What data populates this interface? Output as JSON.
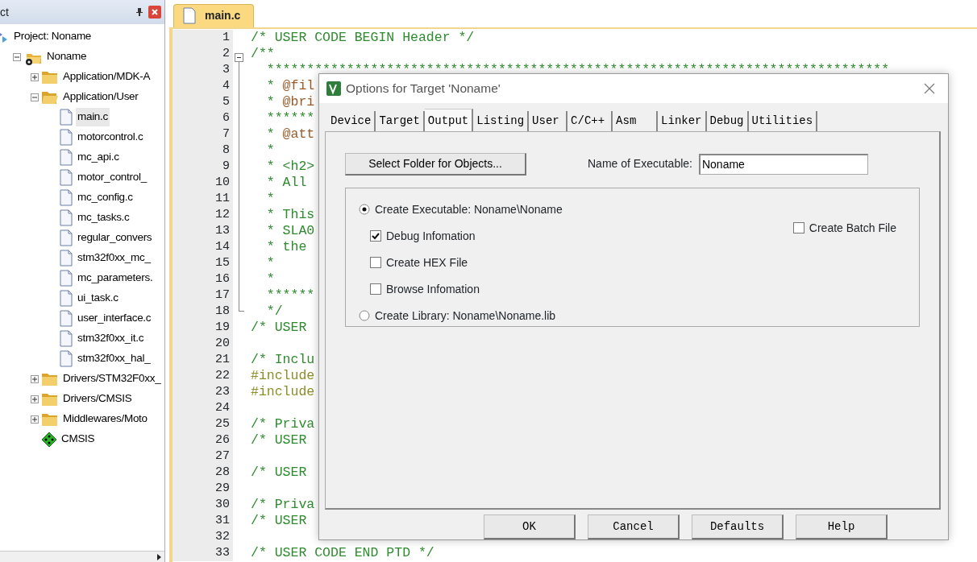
{
  "project_panel": {
    "title": "ct",
    "tree": [
      {
        "label": "Project: Noname",
        "kind": "project",
        "children": [
          {
            "label": "Noname",
            "kind": "target",
            "expanded": true,
            "children": [
              {
                "label": "Application/MDK-A",
                "kind": "folder",
                "expanded": false
              },
              {
                "label": "Application/User",
                "kind": "folder",
                "expanded": true,
                "children": [
                  {
                    "label": "main.c",
                    "kind": "file",
                    "selected": true
                  },
                  {
                    "label": "motorcontrol.c",
                    "kind": "file",
                    "selected": false
                  },
                  {
                    "label": "mc_api.c",
                    "kind": "file",
                    "selected": false
                  },
                  {
                    "label": "motor_control_",
                    "kind": "file",
                    "selected": false
                  },
                  {
                    "label": "mc_config.c",
                    "kind": "file",
                    "selected": false
                  },
                  {
                    "label": "mc_tasks.c",
                    "kind": "file",
                    "selected": false
                  },
                  {
                    "label": "regular_convers",
                    "kind": "file",
                    "selected": false
                  },
                  {
                    "label": "stm32f0xx_mc_",
                    "kind": "file",
                    "selected": false
                  },
                  {
                    "label": "mc_parameters.",
                    "kind": "file",
                    "selected": false
                  },
                  {
                    "label": "ui_task.c",
                    "kind": "file",
                    "selected": false
                  },
                  {
                    "label": "user_interface.c",
                    "kind": "file",
                    "selected": false
                  },
                  {
                    "label": "stm32f0xx_it.c",
                    "kind": "file",
                    "selected": false
                  },
                  {
                    "label": "stm32f0xx_hal_",
                    "kind": "file",
                    "selected": false
                  }
                ]
              },
              {
                "label": "Drivers/STM32F0xx_",
                "kind": "folder",
                "expanded": false
              },
              {
                "label": "Drivers/CMSIS",
                "kind": "folder",
                "expanded": false
              },
              {
                "label": "Middlewares/Moto",
                "kind": "folder",
                "expanded": false
              },
              {
                "label": "CMSIS",
                "kind": "component"
              }
            ]
          }
        ]
      }
    ]
  },
  "editor": {
    "tab": "main.c",
    "lines": [
      {
        "number": "1",
        "kind": "comment",
        "text": "/* USER CODE BEGIN Header */"
      },
      {
        "number": "2",
        "kind": "comment",
        "text": "/**",
        "expanded": true,
        "children": [
          {
            "number": "3",
            "kind": "comment",
            "text": "  ******************************************************************************"
          },
          {
            "number": "4",
            "kind": "comment",
            "text": "  * ",
            "tag": "@fil"
          },
          {
            "number": "5",
            "kind": "comment",
            "text": "  * ",
            "tag": "@bri"
          },
          {
            "number": "6",
            "kind": "comment",
            "text": "  ******"
          },
          {
            "number": "7",
            "kind": "comment",
            "text": "  * ",
            "tag": "@att"
          },
          {
            "number": "8",
            "kind": "comment",
            "text": "  *"
          },
          {
            "number": "9",
            "kind": "comment",
            "text": "  * <h2>"
          },
          {
            "number": "10",
            "kind": "comment",
            "text": "  * All"
          },
          {
            "number": "11",
            "kind": "comment",
            "text": "  *"
          },
          {
            "number": "12",
            "kind": "comment",
            "text": "  * This"
          },
          {
            "number": "13",
            "kind": "comment",
            "text": "  * SLA0"
          },
          {
            "number": "14",
            "kind": "comment",
            "text": "  * the"
          },
          {
            "number": "15",
            "kind": "comment",
            "text": "  *"
          },
          {
            "number": "16",
            "kind": "comment",
            "text": "  *"
          },
          {
            "number": "17",
            "kind": "comment",
            "text": "  ******"
          },
          {
            "number": "18",
            "kind": "comment",
            "text": "  */"
          }
        ]
      },
      {
        "number": "19",
        "kind": "comment",
        "text": "/* USER"
      },
      {
        "number": "20"
      },
      {
        "number": "21",
        "kind": "comment",
        "text": "/* Inclu"
      },
      {
        "number": "22",
        "kind": "preprocessor",
        "text": "#include"
      },
      {
        "number": "23",
        "kind": "preprocessor",
        "text": "#include"
      },
      {
        "number": "24"
      },
      {
        "number": "25",
        "kind": "comment",
        "text": "/* Priva"
      },
      {
        "number": "26",
        "kind": "comment",
        "text": "/* USER"
      },
      {
        "number": "27"
      },
      {
        "number": "28",
        "kind": "comment",
        "text": "/* USER"
      },
      {
        "number": "29"
      },
      {
        "number": "30",
        "kind": "comment",
        "text": "/* Priva"
      },
      {
        "number": "31",
        "kind": "comment",
        "text": "/* USER"
      },
      {
        "number": "32"
      },
      {
        "number": "33",
        "kind": "comment",
        "text": "/* USER CODE END PTD */"
      }
    ]
  },
  "dialog": {
    "title": "Options for Target 'Noname'",
    "tabs": [
      {
        "label": "Device",
        "selected": false
      },
      {
        "label": "Target",
        "selected": false
      },
      {
        "label": "Output",
        "selected": true
      },
      {
        "label": "Listing",
        "selected": false
      },
      {
        "label": "User",
        "selected": false
      },
      {
        "label": "C/C++",
        "selected": false
      },
      {
        "label": "Asm",
        "selected": false
      },
      {
        "label": "Linker",
        "selected": false
      },
      {
        "label": "Debug",
        "selected": false
      },
      {
        "label": "Utilities",
        "selected": false
      }
    ],
    "select_folder_button": "Select Folder for Objects...",
    "executable_name": {
      "label": "Name of Executable:",
      "value": "Noname"
    },
    "options": [
      {
        "kind": "radio",
        "label": "Create Executable:  Noname\\Noname",
        "selected": true
      },
      {
        "kind": "checkbox",
        "label": "Debug Infomation",
        "checked": true
      },
      {
        "kind": "checkbox",
        "label": "Create HEX File",
        "checked": false
      },
      {
        "kind": "checkbox",
        "label": "Browse Infomation",
        "checked": false
      },
      {
        "kind": "radio",
        "label": "Create Library:  Noname\\Noname.lib",
        "selected": false
      }
    ],
    "batch_file": {
      "label": "Create Batch File",
      "checked": false
    },
    "buttons": [
      "OK",
      "Cancel",
      "Defaults",
      "Help"
    ]
  }
}
